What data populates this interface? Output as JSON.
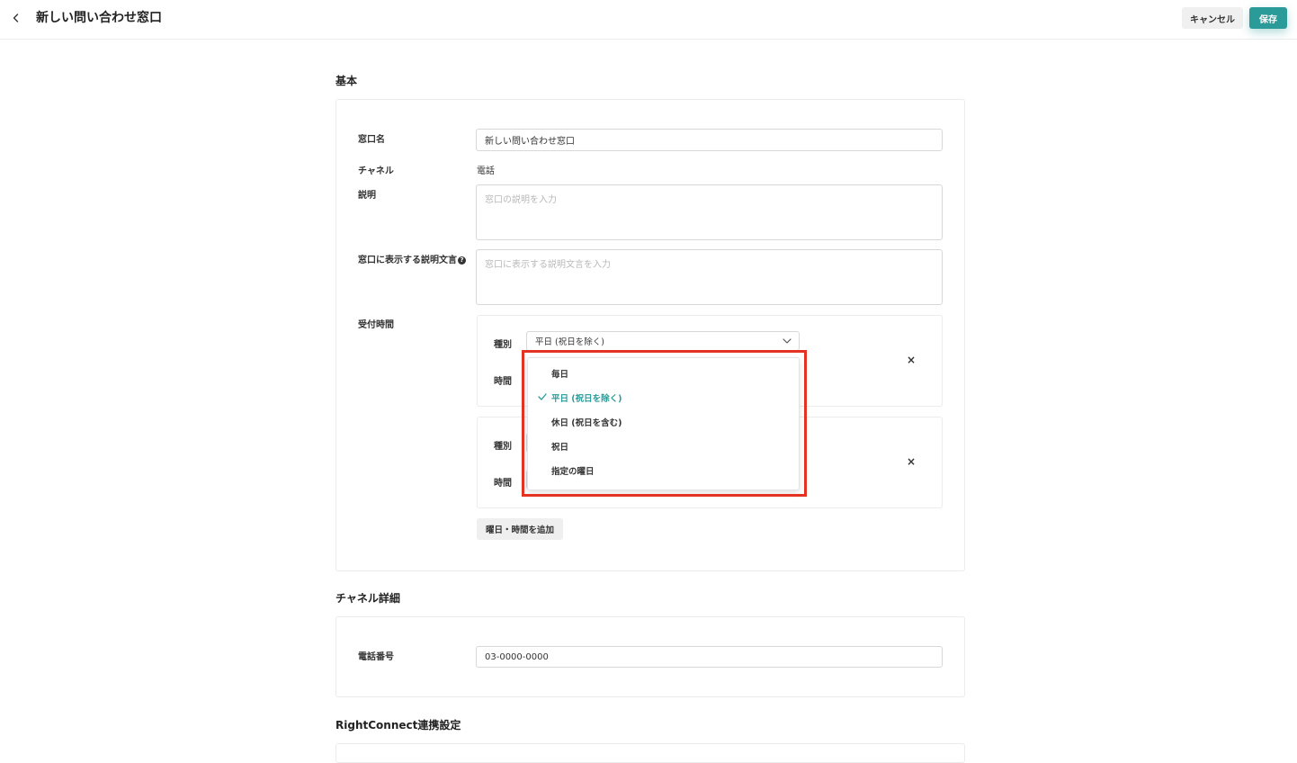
{
  "header": {
    "title": "新しい問い合わせ窓口",
    "cancel_label": "キャンセル",
    "save_label": "保存"
  },
  "colors": {
    "accent": "#2a9b99",
    "highlight": "#e53323"
  },
  "basic": {
    "section_title": "基本",
    "window_name_label": "窓口名",
    "window_name_value": "新しい問い合わせ窓口",
    "channel_label": "チャネル",
    "channel_value": "電話",
    "description_label": "説明",
    "description_placeholder": "窓口の説明を入力",
    "display_text_label": "窓口に表示する説明文言",
    "display_text_placeholder": "窓口に表示する説明文言を入力",
    "reception_label": "受付時間",
    "slots": [
      {
        "type_label": "種別",
        "type_value": "平日 (祝日を除く)",
        "time_label": "時間",
        "remove": "×"
      },
      {
        "type_label": "種別",
        "time_label": "時間",
        "remove": "×"
      }
    ],
    "add_slot_label": "曜日・時間を追加"
  },
  "dropdown": {
    "options": [
      "毎日",
      "平日 (祝日を除く)",
      "休日 (祝日を含む)",
      "祝日",
      "指定の曜日"
    ],
    "selected_index": 1
  },
  "channel_detail": {
    "section_title": "チャネル詳細",
    "phone_label": "電話番号",
    "phone_value": "03-0000-0000"
  },
  "rightconnect": {
    "section_title": "RightConnect連携設定"
  }
}
